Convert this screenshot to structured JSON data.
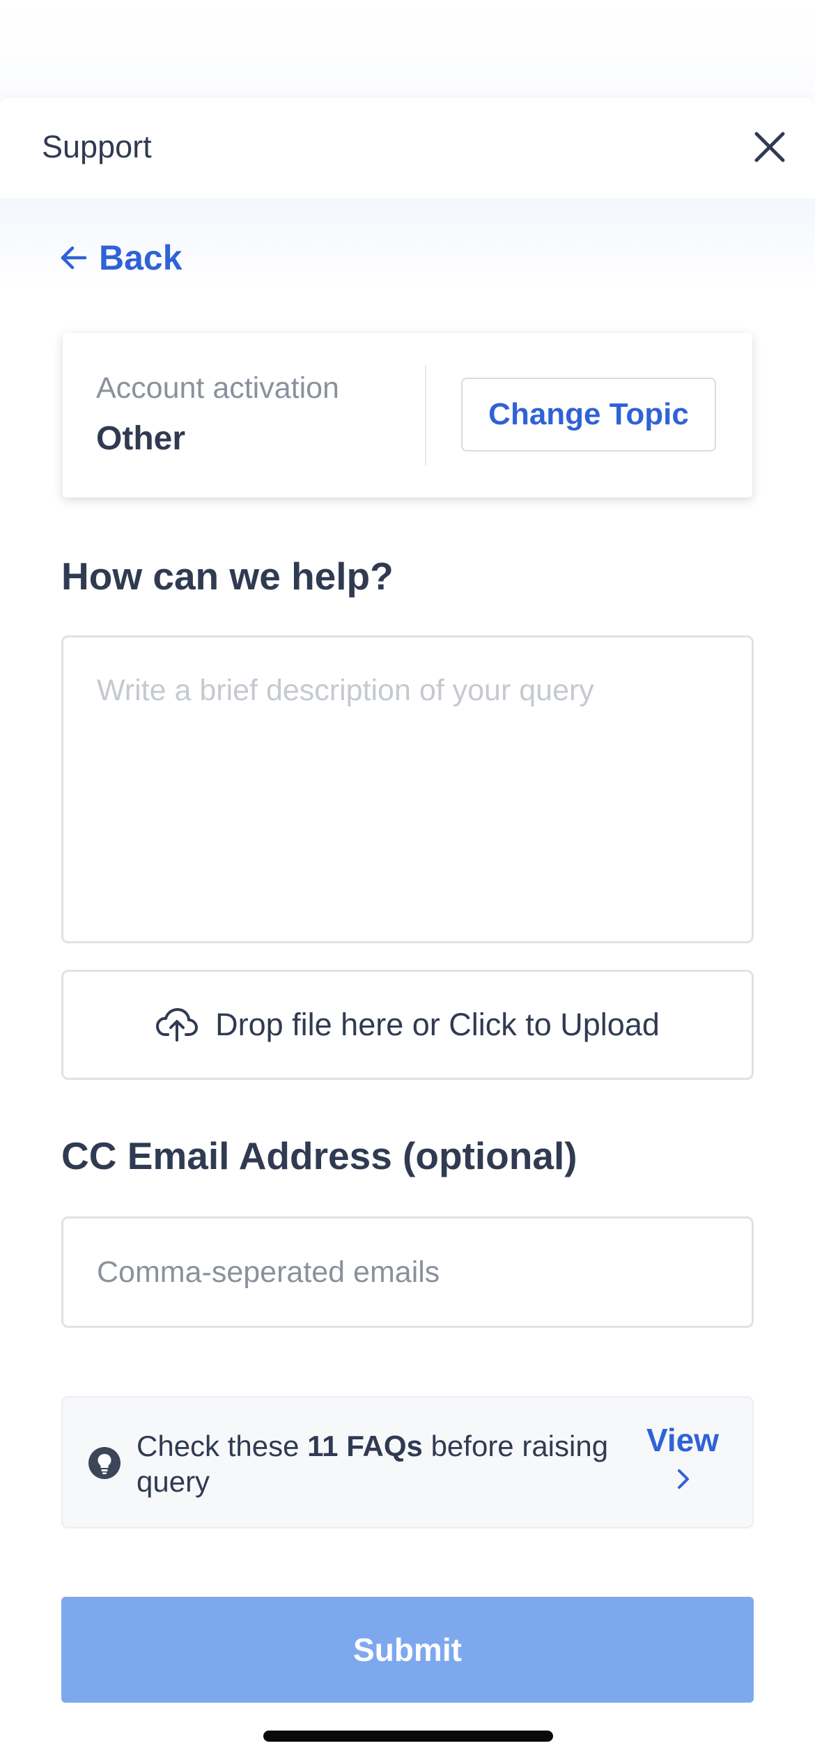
{
  "header": {
    "title": "Support",
    "close_icon": "close-icon"
  },
  "back": {
    "label": "Back",
    "icon": "arrow-left-icon"
  },
  "topic": {
    "category": "Account activation",
    "name": "Other",
    "change_label": "Change Topic"
  },
  "help": {
    "heading": "How can we help?",
    "description_placeholder": "Write a brief description of your query",
    "description_value": ""
  },
  "upload": {
    "label": "Drop file here or Click to Upload",
    "icon": "cloud-upload-icon"
  },
  "cc": {
    "heading": "CC Email Address (optional)",
    "placeholder": "Comma-seperated emails",
    "value": ""
  },
  "faq": {
    "text_before": "Check these ",
    "count_label": "11 FAQs",
    "text_after": " before raising query",
    "view_label": "View",
    "icon": "lightbulb-icon",
    "chevron_icon": "chevron-right-icon"
  },
  "submit": {
    "label": "Submit"
  },
  "colors": {
    "accent": "#2f62d6",
    "submit_disabled": "#7ea8ee",
    "text": "#303b52",
    "muted": "#8a919c"
  }
}
